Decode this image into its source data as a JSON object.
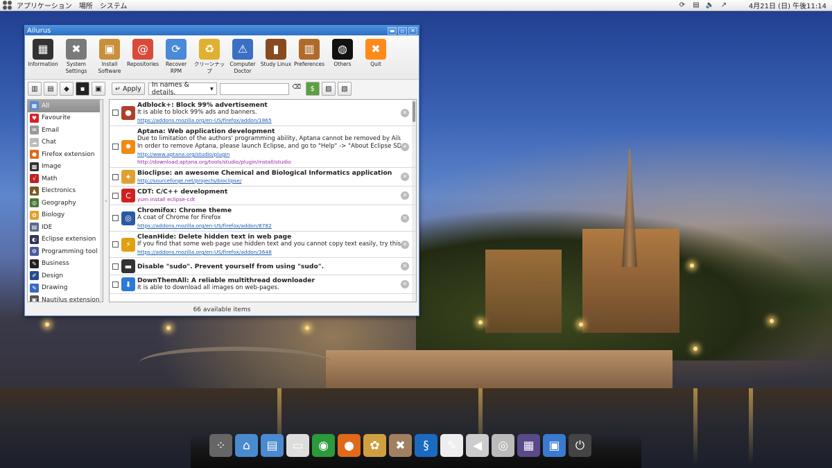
{
  "top_panel": {
    "menus": [
      "アプリケーション",
      "場所",
      "システム"
    ],
    "clock": "4月21日 (日) 午後11:14"
  },
  "window": {
    "title": "Ailurus",
    "buttons": {
      "minimize": "▬",
      "maximize": "▫",
      "close": "✕"
    },
    "toolbar": [
      {
        "label": "Information",
        "icon": "info-icon",
        "color": "#333333"
      },
      {
        "label": "System Settings",
        "icon": "tools-icon",
        "color": "#7a7a7a"
      },
      {
        "label": "Install Software",
        "icon": "package-icon",
        "color": "#c8903a"
      },
      {
        "label": "Repositories",
        "icon": "repositories-icon",
        "color": "#d94a3a"
      },
      {
        "label": "Recover RPM",
        "icon": "recover-icon",
        "color": "#4a8ad8"
      },
      {
        "label": "クリーンナップ",
        "icon": "trash-icon",
        "color": "#e0b030"
      },
      {
        "label": "Computer Doctor",
        "icon": "doctor-icon",
        "color": "#3a6fc4"
      },
      {
        "label": "Study Linux",
        "icon": "book-icon",
        "color": "#8a4a20"
      },
      {
        "label": "Preferences",
        "icon": "equalizer-icon",
        "color": "#b06a2a"
      },
      {
        "label": "Others",
        "icon": "others-icon",
        "color": "#111111"
      },
      {
        "label": "Quit",
        "icon": "quit-icon",
        "color": "#ff8a1a"
      }
    ],
    "filter": {
      "apply_label": "Apply",
      "search_mode": "In names & details.",
      "search_value": ""
    },
    "categories": [
      {
        "label": "All",
        "icon": "all-icon",
        "color": "#5a8ad0"
      },
      {
        "label": "Favourite",
        "icon": "heart-icon",
        "color": "#d8202a"
      },
      {
        "label": "Email",
        "icon": "email-icon",
        "color": "#9a9a9a"
      },
      {
        "label": "Chat",
        "icon": "chat-icon",
        "color": "#bbbbbb"
      },
      {
        "label": "Firefox extension",
        "icon": "firefox-icon",
        "color": "#e06a1a"
      },
      {
        "label": "Image",
        "icon": "image-icon",
        "color": "#333333"
      },
      {
        "label": "Math",
        "icon": "math-icon",
        "color": "#c02020"
      },
      {
        "label": "Electronics",
        "icon": "electronics-icon",
        "color": "#7a5a20"
      },
      {
        "label": "Geography",
        "icon": "globe-icon",
        "color": "#4a7a3a"
      },
      {
        "label": "Biology",
        "icon": "biology-icon",
        "color": "#e0a030"
      },
      {
        "label": "IDE",
        "icon": "ide-icon",
        "color": "#5a6a8a"
      },
      {
        "label": "Eclipse extension",
        "icon": "eclipse-icon",
        "color": "#333355"
      },
      {
        "label": "Programming tool",
        "icon": "programming-icon",
        "color": "#4a5a9a"
      },
      {
        "label": "Business",
        "icon": "business-icon",
        "color": "#222222"
      },
      {
        "label": "Design",
        "icon": "design-icon",
        "color": "#2a4a8a"
      },
      {
        "label": "Drawing",
        "icon": "drawing-icon",
        "color": "#3a6ac0"
      },
      {
        "label": "Nautilus extension",
        "icon": "nautilus-icon",
        "color": "#555555"
      }
    ],
    "items": [
      {
        "name": "Adblock+: Block 99% advertisement",
        "desc": [
          "It is able to block 99% ads and banners."
        ],
        "urls": [
          "https://addons.mozilla.org/en-US/firefox/addon/1865"
        ],
        "cmds": [],
        "icon": "adblock-icon",
        "color": "#b0402a"
      },
      {
        "name": "Aptana: Web application development",
        "desc": [
          "Due to limitation of the authors' programming ability, Aptana cannot be removed by Ailurus.",
          "In order to remove Aptana, please launch Eclipse, and go to \"Help\" -> \"About Eclipse SDK\" ···"
        ],
        "urls": [
          "http://www.aptana.org/studio/plugin"
        ],
        "cmds": [
          "http://download.aptana.org/tools/studio/plugin/install/studio"
        ],
        "icon": "aptana-icon",
        "color": "#f08a10"
      },
      {
        "name": "Bioclipse: an awesome Chemical and Biological Informatics application",
        "desc": [],
        "urls": [
          "http://sourceforge.net/projects/bioclipse/"
        ],
        "cmds": [],
        "icon": "bioclipse-icon",
        "color": "#e0a030"
      },
      {
        "name": "CDT: C/C++ development",
        "desc": [],
        "urls": [],
        "cmds": [
          "yum install eclipse-cdt"
        ],
        "icon": "cdt-icon",
        "color": "#d02020"
      },
      {
        "name": "Chromifox: Chrome theme",
        "desc": [
          "A coat of Chrome for Firefox"
        ],
        "urls": [
          "https://addons.mozilla.org/en-US/firefox/addon/8782"
        ],
        "cmds": [],
        "icon": "chromifox-icon",
        "color": "#2a5aa0"
      },
      {
        "name": "CleanHide: Delete hidden text in web page",
        "desc": [
          "If you find that some web page use hidden text and you cannot copy text easily, try this!"
        ],
        "urls": [
          "https://addons.mozilla.org/en-US/firefox/addon/3648"
        ],
        "cmds": [],
        "icon": "cleanhide-icon",
        "color": "#e0a010"
      },
      {
        "name": "Disable \"sudo\". Prevent yourself from using \"sudo\".",
        "desc": [],
        "urls": [],
        "cmds": [],
        "icon": "terminal-icon",
        "color": "#333333"
      },
      {
        "name": "DownThemAll: A reliable multithread downloader",
        "desc": [
          "It is able to download all images on web-pages."
        ],
        "urls": [],
        "cmds": [],
        "icon": "download-icon",
        "color": "#2a7ad8"
      }
    ],
    "status": "66 available items"
  },
  "dock": [
    {
      "icon": "apps-icon",
      "color": "#666666"
    },
    {
      "icon": "home-folder-icon",
      "color": "#4a8ad0"
    },
    {
      "icon": "documents-folder-icon",
      "color": "#4a8ad0"
    },
    {
      "icon": "ailurus-icon",
      "color": "#dddddd"
    },
    {
      "icon": "chrome-icon",
      "color": "#2a9a3a"
    },
    {
      "icon": "firefox-icon",
      "color": "#e06a1a"
    },
    {
      "icon": "paint-icon",
      "color": "#d0a040"
    },
    {
      "icon": "tools-icon",
      "color": "#a08060"
    },
    {
      "icon": "swirl-icon",
      "color": "#1a6ac0"
    },
    {
      "icon": "text-editor-icon",
      "color": "#eeeeee"
    },
    {
      "icon": "volume-icon",
      "color": "#cccccc"
    },
    {
      "icon": "cd-icon",
      "color": "#bbbbbb"
    },
    {
      "icon": "workspace-icon",
      "color": "#5a4a8a"
    },
    {
      "icon": "window-icon",
      "color": "#3a7ad0"
    },
    {
      "icon": "power-icon",
      "color": "#444444"
    }
  ]
}
